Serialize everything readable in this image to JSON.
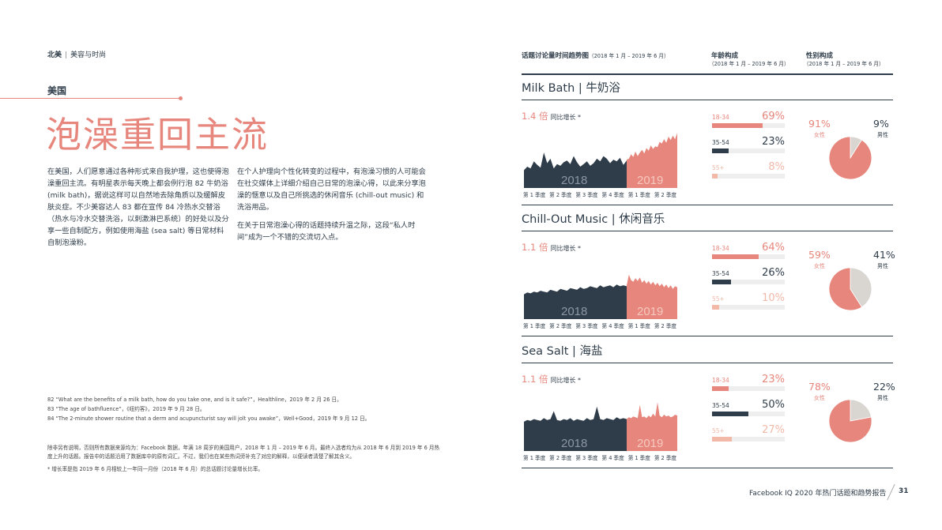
{
  "header": {
    "region": "北美",
    "topic": "美容与时尚"
  },
  "country": "美国",
  "title": "泡澡重回主流",
  "body": {
    "col1": "在美国，人们愿意通过各种形式来自我护理，这也使得泡澡重回主流。有明星表示每天晚上都会例行泡 82 牛奶浴 (milk bath)，据说这样可以自然地去除角质以及缓解皮肤炎症。不少美容达人 83 都在宣传 84 冷热水交替浴（热水与冷水交替洗浴，以刺激淋巴系统）的好处以及分享一些自制配方，例如使用海盐 (sea salt) 等日常材料自制泡澡粉。",
    "col2_p1": "在个人护理向个性化转变的过程中，有泡澡习惯的人可能会在社交媒体上详细介绍自己日常的泡澡心得，以此来分享泡澡的惬意以及自己所挑选的休闲音乐 (chill-out music) 和洗浴用品。",
    "col2_p2": "在关于日常泡澡心得的话题持续升温之际，这段“私人时间”成为一个不错的交流切入点。"
  },
  "notes": [
    "82    “What are the benefits of a milk bath, how do you take one, and is it safe?”，Healthline，2019 年 2 月 26 日。",
    "83    “The age of bathfluence”，《纽约客》，2019 年 9 月 28 日。",
    "84    “The 2-minute shower routine that a derm and acupuncturist say will jolt you awake”，Well+Good，2019 年 9 月 12 日。"
  ],
  "disclaimer": "除非另有说明，否则所有数据来源均为：Facebook 数据，年满 18 周岁的美国用户，2018 年 1 月 – 2019 年 6 月。最终入选者均为从 2018 年 6 月到 2019 年 6 月热度上升的话题。报告中的话题沿用了数据库中的原有词汇。不过，我们也在某些热词旁补充了对应的解释，以便读者清楚了解其含义。",
  "growth_note": "* 增长率是指 2019 年 6 月相较上一年同一月份（2018 年 6 月）的总话题讨论量增长比率。",
  "columns": {
    "trend_title": "话题讨论量时间趋势图",
    "trend_range": "（2018 年 1 月 – 2019 年 6 月）",
    "age_title": "年龄构成",
    "age_range": "（2018 年 1 月 – 2019 年 6 月）",
    "gender_title": "性别构成",
    "gender_range": "（2018 年 1 月 – 2019 年 6 月）"
  },
  "growth_label": "同比增长 *",
  "quarters": [
    "第 1 季度",
    "第 2 季度",
    "第 3 季度",
    "第 4 季度",
    "第 1 季度",
    "第 2 季度"
  ],
  "years": [
    "2018",
    "2019"
  ],
  "age_groups": [
    "18-34",
    "35-54",
    "55+"
  ],
  "gender_labels": {
    "female": "女性",
    "male": "男性"
  },
  "colors": {
    "coral": "#e7867c",
    "navy": "#2f3d4a",
    "peach": "#f2b8a8",
    "grey": "#d9d6d2"
  },
  "chart_data": [
    {
      "type": "area",
      "title": "Milk Bath | 牛奶浴",
      "growth": "1.4 倍",
      "series": [
        {
          "name": "2018",
          "values": [
            20,
            24,
            22,
            30,
            26,
            23,
            40,
            28,
            33,
            22,
            27,
            25,
            29,
            31,
            27,
            36,
            29,
            24,
            27,
            30,
            25,
            28,
            33,
            30,
            36,
            33,
            28,
            32,
            30,
            34,
            26,
            31
          ]
        },
        {
          "name": "2019",
          "values": [
            32,
            33,
            38,
            35,
            41,
            36,
            40,
            43,
            39,
            45,
            42,
            48,
            44,
            47,
            46,
            52,
            50,
            55,
            51,
            58,
            54,
            59,
            55,
            62
          ]
        }
      ],
      "age": [
        69,
        23,
        8
      ],
      "gender": {
        "female": 91,
        "male": 9
      }
    },
    {
      "type": "area",
      "title": "Chill-Out Music | 休闲音乐",
      "growth": "1.1 倍",
      "series": [
        {
          "name": "2018",
          "values": [
            28,
            30,
            29,
            31,
            30,
            32,
            31,
            30,
            33,
            32,
            31,
            34,
            33,
            32,
            35,
            34,
            33,
            36,
            34,
            35,
            37,
            36,
            35,
            38,
            36,
            37,
            38,
            36,
            39,
            37,
            38,
            37
          ]
        },
        {
          "name": "2019",
          "values": [
            38,
            50,
            44,
            42,
            46,
            43,
            47,
            41,
            44,
            40,
            43,
            39,
            42,
            38,
            41,
            37,
            40,
            36,
            39,
            35,
            38,
            34,
            37,
            36
          ]
        }
      ],
      "age": [
        64,
        26,
        10
      ],
      "gender": {
        "female": 59,
        "male": 41
      }
    },
    {
      "type": "area",
      "title": "Sea Salt | 海盐",
      "growth": "1.1 倍",
      "series": [
        {
          "name": "2018",
          "values": [
            33,
            35,
            34,
            36,
            35,
            34,
            37,
            35,
            36,
            45,
            35,
            34,
            36,
            35,
            37,
            34,
            36,
            35,
            34,
            37,
            35,
            36,
            50,
            36,
            35,
            37,
            36,
            35,
            38,
            36,
            37,
            36
          ]
        },
        {
          "name": "2019",
          "values": [
            36,
            38,
            37,
            39,
            38,
            37,
            52,
            38,
            39,
            37,
            40,
            38,
            42,
            39,
            55,
            40,
            38,
            41,
            39,
            40,
            38,
            39,
            41,
            40
          ]
        }
      ],
      "age": [
        23,
        50,
        27
      ],
      "gender": {
        "female": 78,
        "male": 22
      }
    }
  ],
  "footer": {
    "report": "Facebook IQ 2020 年热门话题和趋势报告",
    "page": "31"
  }
}
